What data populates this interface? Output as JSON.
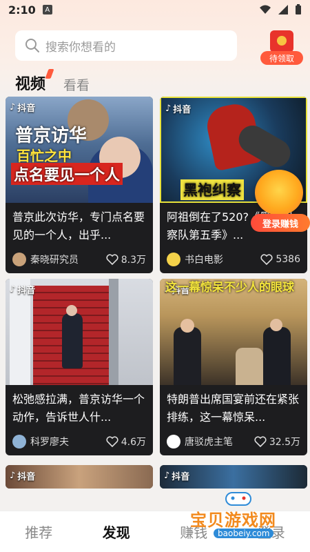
{
  "status": {
    "time": "2:10",
    "notif_badge": "A"
  },
  "search": {
    "placeholder": "搜索你想看的"
  },
  "reward": {
    "label": "待领取"
  },
  "tabs": [
    {
      "label": "视频"
    },
    {
      "label": "看看"
    }
  ],
  "cards": [
    {
      "title": "普京此次访华，专门点名要见的一个人，出乎...",
      "author": "秦晓研究员",
      "likes": "8.3万",
      "source": "抖音",
      "thumb_lines": [
        "普京访华",
        "百忙之中",
        "点名要见一个人"
      ]
    },
    {
      "title": "阿祖倒在了520?《黑袍纠察队第五季》...",
      "author": "书白电影",
      "likes": "5386",
      "source": "抖音",
      "thumb_lines": [
        "黑袍纠察"
      ]
    },
    {
      "title": "松弛感拉满，普京访华一个动作，告诉世人什...",
      "author": "科罗廖夫",
      "likes": "4.6万",
      "source": "抖音",
      "thumb_lines": []
    },
    {
      "title": "特朗普出席国宴前还在紧张排练，这一幕惊呆...",
      "author": "唐驳虎主笔",
      "likes": "32.5万",
      "source": "抖音",
      "thumb_lines": [
        "这一幕惊呆不少人的眼球"
      ]
    },
    {
      "source": "抖音"
    },
    {
      "source": "抖音"
    }
  ],
  "float_login": {
    "label": "登录赚钱"
  },
  "bottom_nav": [
    {
      "label": "推荐"
    },
    {
      "label": "发现",
      "active": true
    },
    {
      "label": "赚钱"
    },
    {
      "label": "登录"
    }
  ],
  "watermark": {
    "text": "宝贝游戏网",
    "url": "baobeiy.com"
  },
  "colors": {
    "accent": "#ff5a3c",
    "card_bg": "#1d1d1f",
    "page_bg": "#f3f1ef"
  }
}
